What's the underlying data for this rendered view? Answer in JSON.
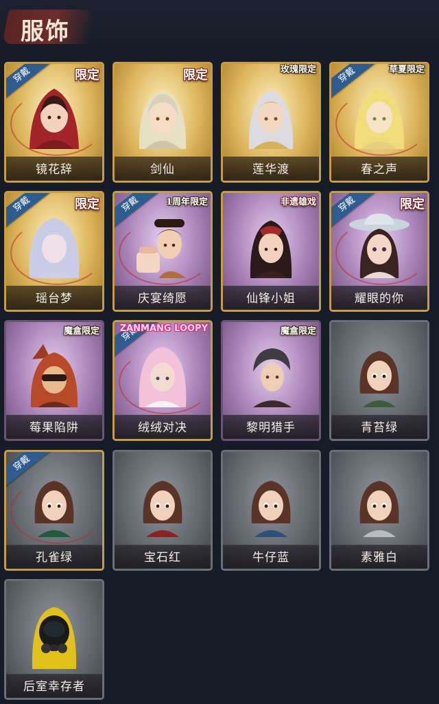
{
  "header": {
    "title": "服饰"
  },
  "equipped_label": "穿戴",
  "outfits": [
    {
      "name": "镜花辞",
      "badge": "限定",
      "equipped": true
    },
    {
      "name": "剑仙",
      "badge": "限定",
      "equipped": false
    },
    {
      "name": "莲华渡",
      "badge": "玫瑰限定",
      "equipped": false
    },
    {
      "name": "春之声",
      "badge": "草夏限定",
      "equipped": true
    },
    {
      "name": "瑶台梦",
      "badge": "限定",
      "equipped": true
    },
    {
      "name": "庆宴绮愿",
      "badge": "1周年限定",
      "equipped": true
    },
    {
      "name": "仙锋小姐",
      "badge": "非遗雄戏",
      "equipped": false
    },
    {
      "name": "耀眼的你",
      "badge": "限定",
      "equipped": true
    },
    {
      "name": "莓果陷阱",
      "badge": "魔盒限定",
      "equipped": false
    },
    {
      "name": "绒绒对决",
      "badge": "ZANMANG LOOPY",
      "equipped": true
    },
    {
      "name": "黎明猎手",
      "badge": "魔盒限定",
      "equipped": false
    },
    {
      "name": "青苔绿",
      "badge": "",
      "equipped": false
    },
    {
      "name": "孔雀绿",
      "badge": "",
      "equipped": true
    },
    {
      "name": "宝石红",
      "badge": "",
      "equipped": false
    },
    {
      "name": "牛仔蓝",
      "badge": "",
      "equipped": false
    },
    {
      "name": "素雅白",
      "badge": "",
      "equipped": false
    },
    {
      "name": "后室幸存者",
      "badge": "",
      "equipped": false
    }
  ]
}
